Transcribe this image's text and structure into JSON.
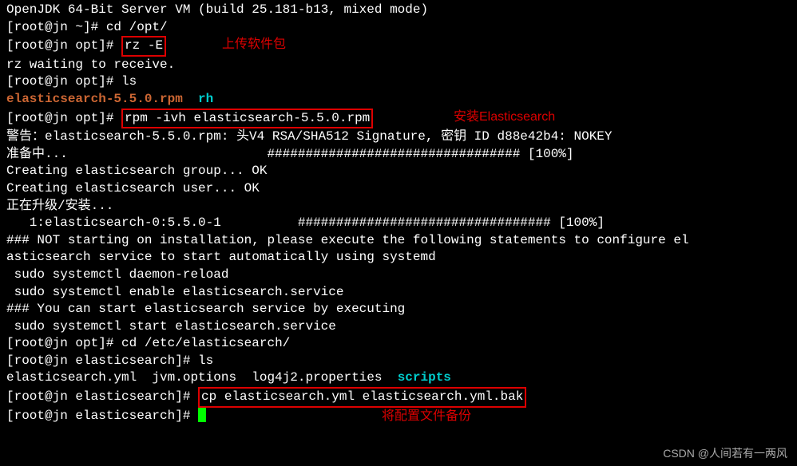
{
  "lines": {
    "l0": "OpenJDK 64-Bit Server VM (build 25.181-b13, mixed mode)",
    "prompt_home": "[root@jn ~]# ",
    "cd_opt": "cd /opt/",
    "prompt_opt": "[root@jn opt]# ",
    "rz_cmd": "rz -E",
    "rz_wait": "rz waiting to receive.",
    "ls_cmd": "ls",
    "es_rpm_file": "elasticsearch-5.5.0.rpm",
    "rh_dir": "rh",
    "rpm_cmd": "rpm -ivh elasticsearch-5.5.0.rpm",
    "warn": "警告：elasticsearch-5.5.0.rpm: 头V4 RSA/SHA512 Signature, 密钥 ID d88e42b4: NOKEY",
    "prep1": "准备中...                          ################################# [100%]",
    "grp": "Creating elasticsearch group... OK",
    "usr": "Creating elasticsearch user... OK",
    "upgrade": "正在升级/安装...",
    "pkg1": "   1:elasticsearch-0:5.5.0-1          ################################# [100%]",
    "not1": "### NOT starting on installation, please execute the following statements to configure el",
    "not2": "asticsearch service to start automatically using systemd",
    "sudo1": " sudo systemctl daemon-reload",
    "sudo2": " sudo systemctl enable elasticsearch.service",
    "start1": "### You can start elasticsearch service by executing",
    "sudo3": " sudo systemctl start elasticsearch.service",
    "cd_etc": "cd /etc/elasticsearch/",
    "prompt_es": "[root@jn elasticsearch]# ",
    "es_yml": "elasticsearch.yml  jvm.options  log4j2.properties  ",
    "scripts": "scripts",
    "cp_cmd": "cp elasticsearch.yml elasticsearch.yml.bak"
  },
  "annotations": {
    "upload": "上传软件包",
    "install": "安装Elasticsearch",
    "backup": "将配置文件备份"
  },
  "watermark": "CSDN @人间若有一两风"
}
